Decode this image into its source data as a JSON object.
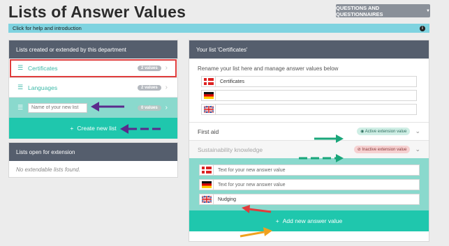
{
  "page": {
    "title": "Lists of Answer Values"
  },
  "top_button": {
    "label": "QUESTIONS AND QUESTIONNAIRES"
  },
  "help_bar": {
    "label": "Click for help and introduction"
  },
  "lists_panel": {
    "title": "Lists created or extended by this department",
    "items": [
      {
        "label": "Certificates",
        "badge": "2 values"
      },
      {
        "label": "Languages",
        "badge": "2 values"
      }
    ],
    "new_list": {
      "placeholder": "Name of your new list",
      "badge": "0 values"
    },
    "create_button": "Create new list"
  },
  "open_panel": {
    "title": "Lists open for extension",
    "empty_message": "No extendable lists found."
  },
  "right_panel": {
    "title": "Your list 'Certificates'",
    "rename_text": "Rename your list here and manage answer values below",
    "name_inputs": [
      {
        "flag": "danish",
        "value": "Certificates"
      },
      {
        "flag": "german",
        "value": ""
      },
      {
        "flag": "uk",
        "value": ""
      }
    ],
    "answer_values": [
      {
        "label": "First aid",
        "status": "Active extension value"
      },
      {
        "label": "Sustainability knowledge",
        "status": "Inactive extension value"
      }
    ],
    "new_value_inputs": [
      {
        "flag": "danish",
        "placeholder": "Text for your new answer value",
        "value": ""
      },
      {
        "flag": "german",
        "placeholder": "Text for your new answer value",
        "value": ""
      },
      {
        "flag": "uk",
        "placeholder": "",
        "value": "Nudging"
      }
    ],
    "add_button": "Add new answer value"
  },
  "colors": {
    "teal": "#1fc7ad",
    "light_teal": "#8ad9cd",
    "header": "#555e6d",
    "help": "#7fd3e0",
    "arrow_purple": "#5b2a8c",
    "arrow_green": "#1aa67a",
    "arrow_red": "#e03c3c",
    "arrow_orange": "#f0a21e"
  }
}
